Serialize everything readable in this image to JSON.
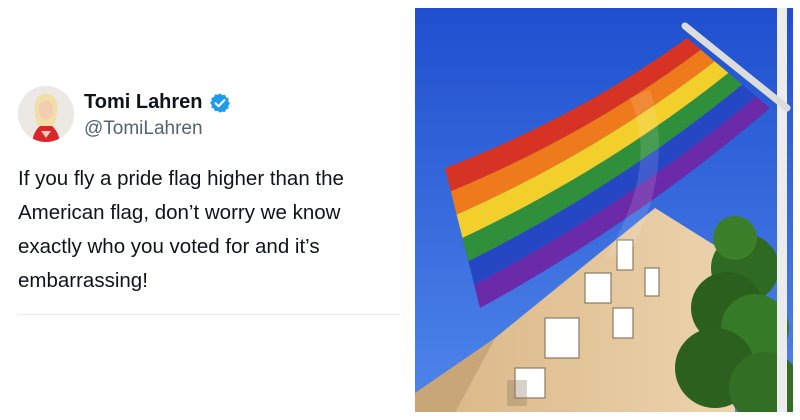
{
  "tweet": {
    "display_name": "Tomi Lahren",
    "handle": "@TomiLahren",
    "text": "If you fly a pride flag higher than the American flag, don’t worry we know exactly who you voted for and it’s embarrassing!",
    "avatar_icon": "user-avatar",
    "verified_icon": "verified-badge-icon",
    "verified_color": "#1d9bf0"
  },
  "photo": {
    "subject": "rainbow-flag-photo",
    "sky_color": "#2a5ed8",
    "building_color": "#e6c79c",
    "tree_color": "#2f6a22",
    "flag_colors": [
      "#d63324",
      "#ef7a1c",
      "#f2cf2a",
      "#2f8f3a",
      "#2647c4",
      "#6b2aa8"
    ]
  }
}
